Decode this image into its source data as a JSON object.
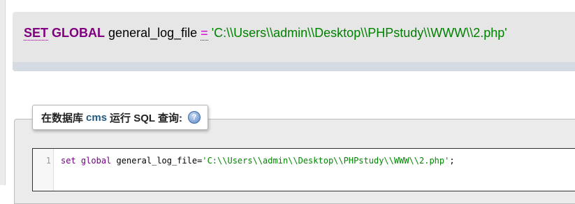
{
  "result_panel": {
    "keyword_set": "SET",
    "keyword_global": "GLOBAL",
    "variable": "general_log_file",
    "operator": "=",
    "value": "'C:\\\\Users\\\\admin\\\\Desktop\\\\PHPstudy\\\\WWW\\\\2.php'"
  },
  "query_box": {
    "legend_prefix": "在数据库",
    "database": "cms",
    "legend_suffix": "运行 SQL 查询:",
    "help_icon": "question-help-icon"
  },
  "editor": {
    "line_number": "1",
    "code_keyword_set": "set",
    "code_keyword_global": "global",
    "code_variable": "general_log_file",
    "code_operator": "=",
    "code_string": "'C:\\\\Users\\\\admin\\\\Desktop\\\\PHPstudy\\\\WWW\\\\2.php'",
    "code_terminator": ";"
  },
  "colors": {
    "keyword": "#800080",
    "string": "#008000",
    "band": "#d5dbe2"
  }
}
